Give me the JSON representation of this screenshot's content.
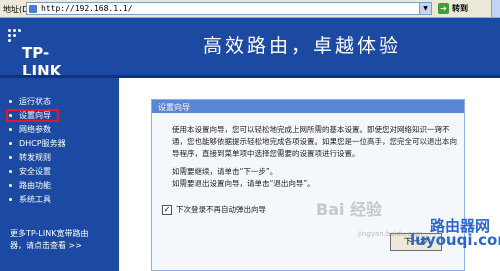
{
  "address_bar": {
    "label": "地址(D)",
    "url": "http://192.168.1.1/",
    "go_label": "转到"
  },
  "header": {
    "logo_text": "TP-LINK",
    "slogan": "高效路由，卓越体验",
    "background": "#1c4aa3"
  },
  "sidebar": {
    "items": [
      {
        "label": "运行状态"
      },
      {
        "label": "设置向导",
        "highlighted": true
      },
      {
        "label": "网络参数"
      },
      {
        "label": "DHCP服务器"
      },
      {
        "label": "转发规则"
      },
      {
        "label": "安全设置"
      },
      {
        "label": "路由功能"
      },
      {
        "label": "系统工具"
      }
    ],
    "more_line1": "更多TP-LINK宽带路由",
    "more_line2": "器，请点击查看 >>",
    "highlight_color": "#e3162e"
  },
  "wizard": {
    "title": "设置向导",
    "paragraph1": "使用本设置向导，您可以轻松地完成上网所需的基本设置。即使您对网络知识一窍不通，您也能够依据提示轻松地完成各项设置。如果您是一位高手，您完全可以退出本向导程序，直接到菜单项中选择您需要的设置项进行设置。",
    "paragraph2": "如需要继续，请单击“下一步”。",
    "paragraph3": "如需要退出设置向导，请单击“退出向导”。",
    "checkbox_label": "下次登录不再自动弹出向导",
    "checkbox_checked": true,
    "next_button": "下一步"
  },
  "watermark": {
    "baidu": "Bai 经验",
    "sub": "jingyan.baidu.com",
    "brand": "路由器网",
    "domain": "luyouqi.com"
  }
}
